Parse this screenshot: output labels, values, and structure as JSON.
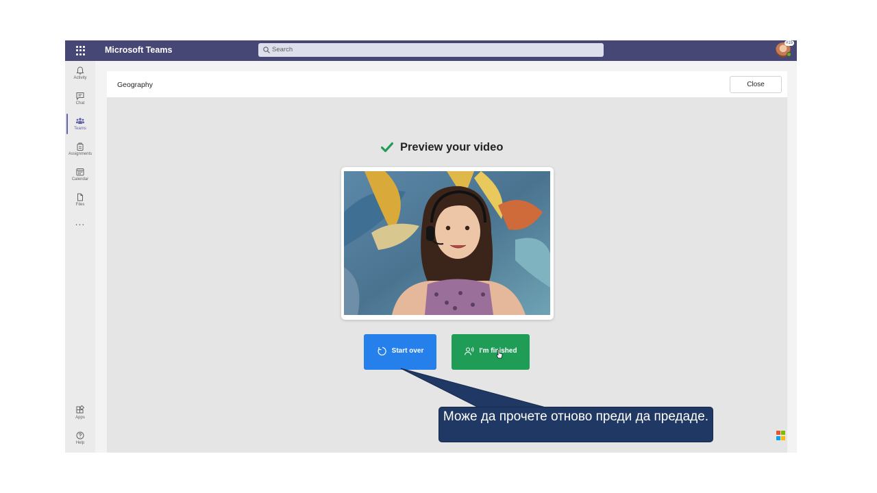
{
  "app": {
    "title": "Microsoft Teams",
    "search_placeholder": "Search",
    "avatar_badge": "#15"
  },
  "rail": {
    "items": [
      {
        "label": "Activity",
        "icon": "bell-icon"
      },
      {
        "label": "Chat",
        "icon": "chat-icon"
      },
      {
        "label": "Teams",
        "icon": "teams-icon"
      },
      {
        "label": "Assignments",
        "icon": "assignments-icon"
      },
      {
        "label": "Calendar",
        "icon": "calendar-icon"
      },
      {
        "label": "Files",
        "icon": "file-icon"
      }
    ],
    "more": "...",
    "bottom": [
      {
        "label": "Apps",
        "icon": "apps-icon"
      },
      {
        "label": "Help",
        "icon": "help-icon"
      }
    ],
    "active": "Teams"
  },
  "panel": {
    "title": "Geography",
    "close_label": "Close",
    "preview_title": "Preview your video",
    "start_over_label": "Start over",
    "finished_label": "I'm finished"
  },
  "callout": {
    "text": "Може да прочете отново преди да предаде."
  },
  "colors": {
    "topbar": "#464775",
    "accent": "#6264a7",
    "start_over": "#2680eb",
    "finished": "#1f9d57",
    "callout": "#203864"
  }
}
